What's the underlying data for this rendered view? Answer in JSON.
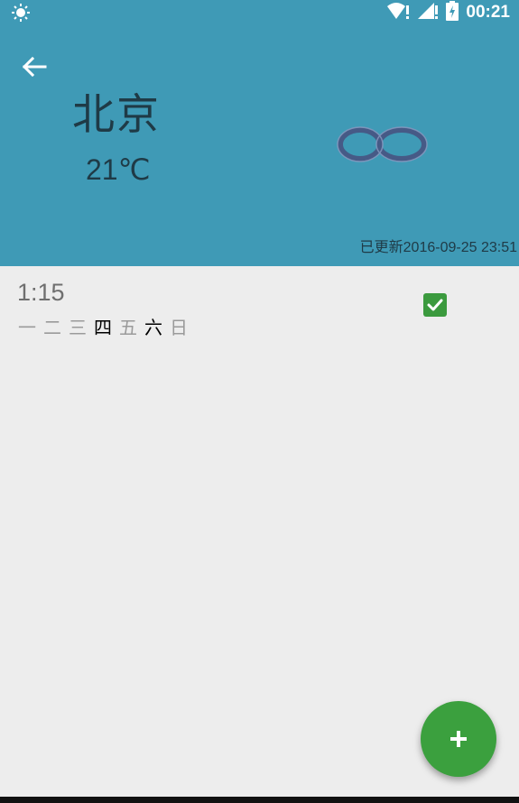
{
  "status_bar": {
    "time": "00:21",
    "icons": [
      "brightness-icon",
      "wifi-icon",
      "signal-icon",
      "battery-charging-icon"
    ]
  },
  "header": {
    "city": "北京",
    "temperature": "21℃",
    "weather_icon": "fog-icon",
    "updated_text": "已更新2016-09-25 23:51",
    "background_color": "#3f9ab6"
  },
  "alarm": {
    "time": "1:15",
    "enabled": true,
    "days": [
      {
        "label": "一",
        "active": false
      },
      {
        "label": "二",
        "active": false
      },
      {
        "label": "三",
        "active": false
      },
      {
        "label": "四",
        "active": true
      },
      {
        "label": "五",
        "active": false
      },
      {
        "label": "六",
        "active": true
      },
      {
        "label": "日",
        "active": false
      }
    ]
  },
  "fab": {
    "icon": "plus-icon",
    "color": "#3ba03e"
  }
}
